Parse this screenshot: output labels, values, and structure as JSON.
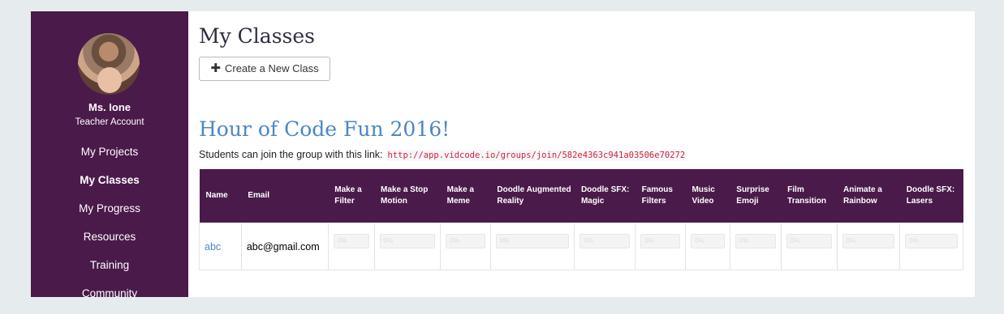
{
  "sidebar": {
    "teacher_name": "Ms. Ione",
    "teacher_role": "Teacher Account",
    "items": [
      {
        "label": "My Projects",
        "active": false
      },
      {
        "label": "My Classes",
        "active": true
      },
      {
        "label": "My Progress",
        "active": false
      },
      {
        "label": "Resources",
        "active": false
      },
      {
        "label": "Training",
        "active": false
      },
      {
        "label": "Community",
        "active": false
      }
    ]
  },
  "main": {
    "title": "My Classes",
    "create_label": "Create a New Class",
    "create_icon": "plus-icon",
    "group": {
      "title": "Hour of Code Fun 2016!",
      "join_text": "Students can join the group with this link:",
      "join_link": "http://app.vidcode.io/groups/join/582e4363c941a03506e70272"
    },
    "table": {
      "headers": [
        "Name",
        "Email",
        "Make a Filter",
        "Make a Stop Motion",
        "Make a Meme",
        "Doodle Augmented Reality",
        "Doodle SFX: Magic",
        "Famous Filters",
        "Music Video",
        "Surprise Emoji",
        "Film Transition",
        "Animate a Rainbow",
        "Doodle SFX: Lasers"
      ],
      "rows": [
        {
          "name": "abc",
          "email": "abc@gmail.com",
          "progress": [
            "0%",
            "0%",
            "0%",
            "0%",
            "0%",
            "0%",
            "0%",
            "0%",
            "0%",
            "0%",
            "0%"
          ]
        }
      ]
    }
  },
  "colors": {
    "sidebar_bg": "#4a1a4a",
    "accent_blue": "#4d86c4",
    "link_red": "#d0243b",
    "page_bg": "#e6ecee"
  }
}
